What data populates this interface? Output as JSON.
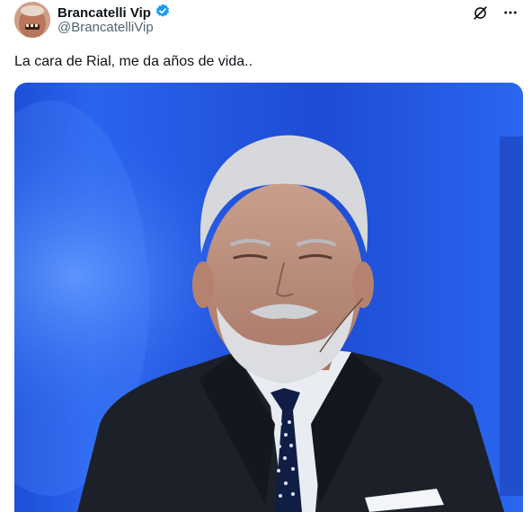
{
  "author": {
    "name": "Brancatelli Vip",
    "handle": "@BrancatelliVip",
    "verified": true,
    "badge_color": "#1d9bf0"
  },
  "tweet": {
    "text": "La cara de Rial, me da años de vida.."
  },
  "icons": {
    "grok": "grok-icon",
    "more": "more-icon",
    "verified": "verified-badge-icon"
  },
  "colors": {
    "text": "#0f1419",
    "secondary": "#536471",
    "accent": "#1d9bf0"
  }
}
